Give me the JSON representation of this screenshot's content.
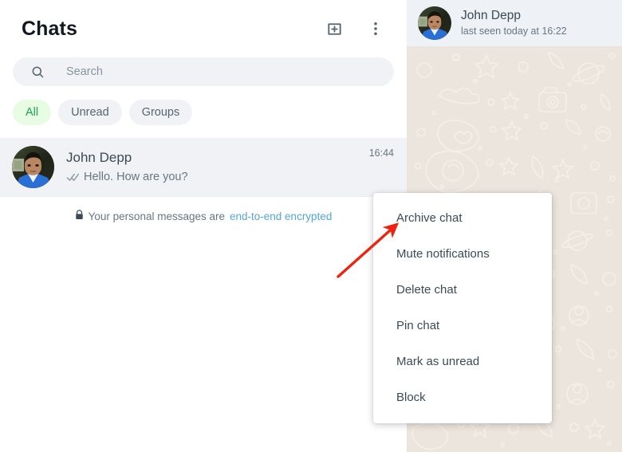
{
  "colors": {
    "accent_green": "#1da457",
    "chip_active_bg": "#e7fce3",
    "link_blue": "#53a6d9",
    "panel_header_bg": "#eef1f6",
    "selected_row_bg": "#f0f2f5",
    "chat_wallpaper": "#ece5dd",
    "arrow_red": "#ee2211",
    "text_primary": "#3b4a54",
    "text_secondary": "#667781"
  },
  "left_panel": {
    "title": "Chats",
    "actions": [
      {
        "name": "new-chat-icon",
        "label": "New chat"
      },
      {
        "name": "menu-icon",
        "label": "Menu"
      }
    ],
    "search": {
      "placeholder": "Search",
      "value": "",
      "icon": "search-icon"
    },
    "filters": [
      {
        "label": "All",
        "active": true
      },
      {
        "label": "Unread",
        "active": false
      },
      {
        "label": "Groups",
        "active": false
      }
    ],
    "chats": [
      {
        "name": "John Depp",
        "preview": "Hello. How are you?",
        "time": "16:44",
        "receipt": "double-check-icon",
        "selected": true
      }
    ],
    "encryption_notice": {
      "icon": "lock-icon",
      "text": "Your personal messages are",
      "link": "end-to-end encrypted"
    }
  },
  "conversation": {
    "contact_name": "John Depp",
    "status": "last seen today at 16:22",
    "avatar": "contact-avatar"
  },
  "context_menu": {
    "items": [
      {
        "label": "Archive chat"
      },
      {
        "label": "Mute notifications"
      },
      {
        "label": "Delete chat"
      },
      {
        "label": "Pin chat"
      },
      {
        "label": "Mark as unread"
      },
      {
        "label": "Block"
      }
    ]
  },
  "annotation": {
    "type": "arrow",
    "points_to": "Archive chat",
    "color": "#ee2211"
  }
}
